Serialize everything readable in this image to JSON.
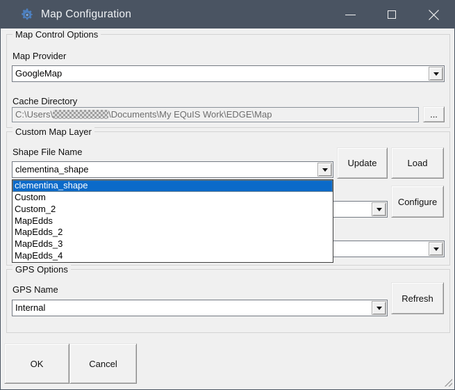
{
  "window": {
    "title": "Map Configuration",
    "app_icon": "gear-icon",
    "controls": {
      "minimize": "minimize-icon",
      "maximize": "maximize-icon",
      "close": "close-icon"
    }
  },
  "map_control_options": {
    "title": "Map Control Options",
    "map_provider": {
      "label": "Map Provider",
      "value": "GoogleMap"
    },
    "cache_directory": {
      "label": "Cache Directory",
      "path_prefix": "C:\\Users\\",
      "path_redacted_segment": "pixelated",
      "path_suffix": "\\Documents\\My EQuIS Work\\EDGE\\Map",
      "browse_button": "..."
    }
  },
  "custom_map_layer": {
    "title": "Custom Map Layer",
    "shape_file_name": {
      "label": "Shape File Name",
      "value": "clementina_shape"
    },
    "update_button": "Update",
    "load_button": "Load",
    "configure_button": "Configure",
    "dropdown": {
      "options": [
        "clementina_shape",
        "Custom",
        "Custom_2",
        "MapEdds",
        "MapEdds_2",
        "MapEdds_3",
        "MapEdds_4"
      ],
      "selected_index": 0
    },
    "secondary_combo_value": "",
    "tertiary_combo_value": ""
  },
  "gps_options": {
    "title": "GPS Options",
    "gps_name": {
      "label": "GPS Name",
      "value": "Internal"
    },
    "refresh_button": "Refresh"
  },
  "footer": {
    "ok_button": "OK",
    "cancel_button": "Cancel"
  },
  "colors": {
    "title_bar": "#4a5462",
    "body_bg": "#f0f0f0",
    "selection_blue": "#0b6ac9"
  }
}
